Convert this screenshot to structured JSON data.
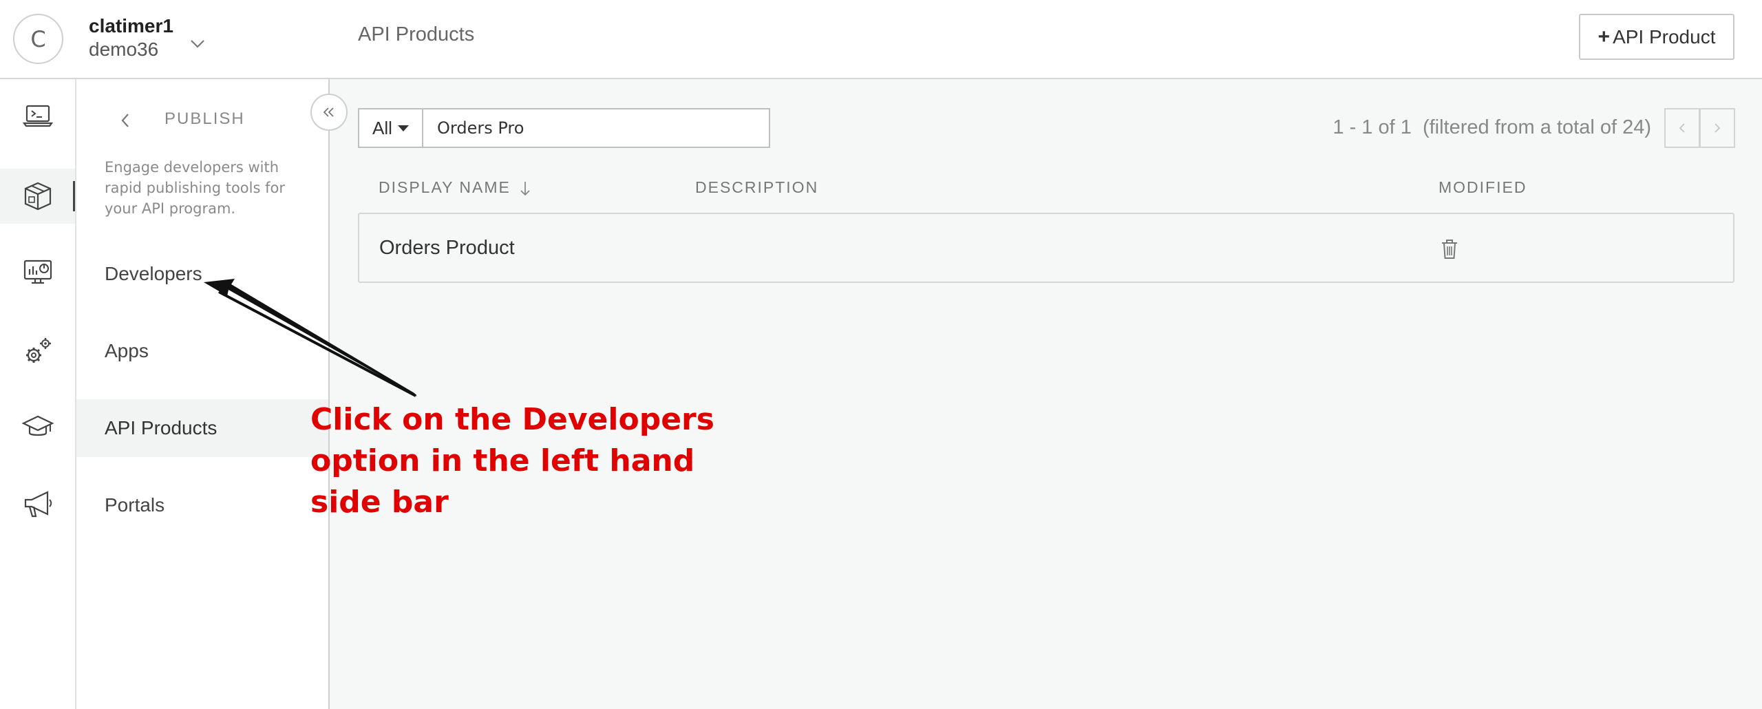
{
  "header": {
    "avatar_initial": "C",
    "user_name": "clatimer1",
    "org_name": "demo36",
    "page_title": "API Products",
    "add_button_plus": "+",
    "add_button_label": "API Product"
  },
  "rail": {
    "items": [
      {
        "icon": "terminal-laptop-icon",
        "active": false
      },
      {
        "icon": "package-box-icon",
        "active": true
      },
      {
        "icon": "analytics-monitor-icon",
        "active": false
      },
      {
        "icon": "gears-icon",
        "active": false
      },
      {
        "icon": "graduation-cap-icon",
        "active": false
      },
      {
        "icon": "megaphone-icon",
        "active": false
      }
    ]
  },
  "subnav": {
    "section_title": "PUBLISH",
    "description": "Engage developers with rapid publishing tools for your API program.",
    "items": [
      {
        "label": "Developers",
        "active": false
      },
      {
        "label": "Apps",
        "active": false
      },
      {
        "label": "API Products",
        "active": true
      },
      {
        "label": "Portals",
        "active": false
      }
    ]
  },
  "main": {
    "filter_value": "All",
    "search_value": "Orders Pro",
    "pager_text": "1 - 1 of 1  (filtered from a total of 24)",
    "columns": {
      "name": "DISPLAY NAME",
      "description": "DESCRIPTION",
      "modified": "MODIFIED"
    },
    "rows": [
      {
        "name": "Orders Product",
        "description": "",
        "modified": ""
      }
    ]
  },
  "annotation": {
    "text": "Click on the Developers option in the left hand side bar",
    "color": "#e00000"
  },
  "colors": {
    "content_background": "#f6f7f7",
    "active_background": "#f2f3f3",
    "annotation_red": "#e00000"
  }
}
